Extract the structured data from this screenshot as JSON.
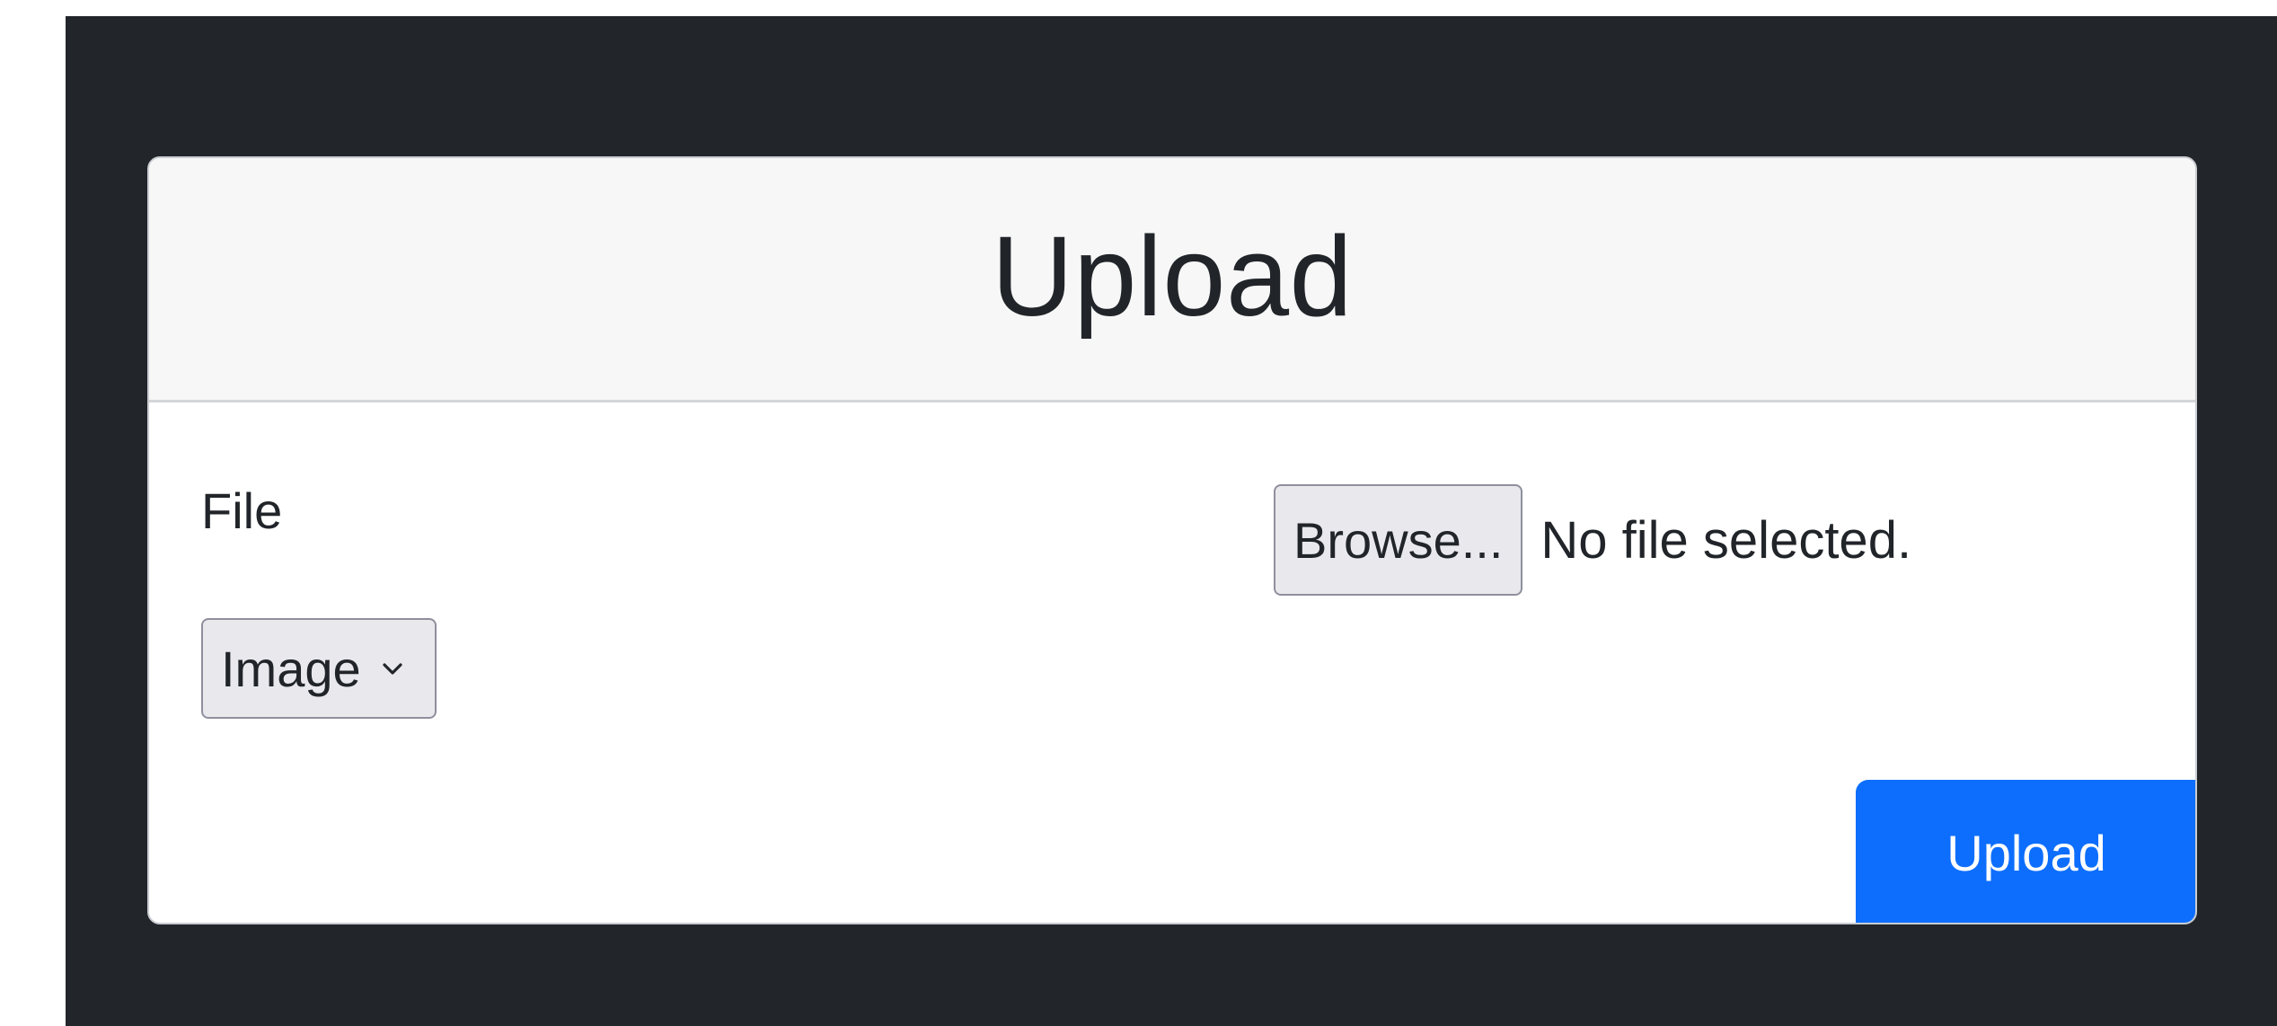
{
  "card": {
    "title": "Upload"
  },
  "form": {
    "file_label": "File",
    "browse_label": "Browse...",
    "file_status": "No file selected.",
    "type_select": {
      "selected": "Image",
      "icon": "chevron-down-icon"
    },
    "submit_label": "Upload"
  },
  "colors": {
    "background_dark": "#222529",
    "card_header": "#f7f7f7",
    "primary": "#0d6efd",
    "control": "#e9e9ed"
  }
}
